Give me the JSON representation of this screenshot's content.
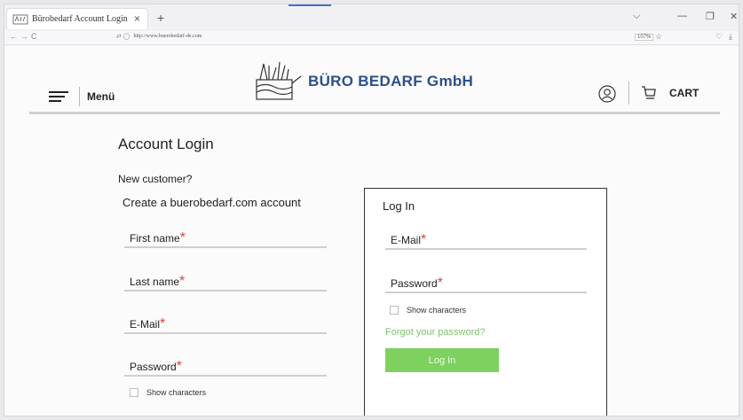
{
  "browser": {
    "tab_title": "Bürobedarf Account Login",
    "tab_close": "×",
    "new_tab": "+",
    "url": "http://www.buerobedarf-de.com",
    "zoom": "107%",
    "controls": {
      "dropdown": "⌵",
      "minimize": "—",
      "restore": "❐",
      "close": "✕"
    },
    "nav": {
      "back": "←",
      "forward": "→",
      "reload": "C"
    },
    "addr_icons": "⇄ ◯",
    "bookmark_star": "☆",
    "nav_right": [
      "♡",
      "⤓"
    ]
  },
  "header": {
    "menu_label": "Menü",
    "brand": "BÜRO BEDARF GmbH",
    "cart_label": "CART",
    "icons": [
      "hamburger-icon",
      "logo-icon",
      "user-icon",
      "cart-icon"
    ]
  },
  "page": {
    "title": "Account Login",
    "new_customer": "New customer?",
    "create_account": "Create a buerobedarf.com account",
    "required_mark": "*",
    "register_fields": {
      "first_name": "First name",
      "last_name": "Last name",
      "email": "E-Mail",
      "password": "Password"
    },
    "show_characters": "Show characters"
  },
  "login": {
    "title": "Log In",
    "email": "E-Mail",
    "password": "Password",
    "show_characters": "Show characters",
    "forgot": "Forgot your password?",
    "button": "Log In"
  },
  "colors": {
    "brand": "#2b4f8f",
    "required": "#d14a4a",
    "link": "#7bc36a",
    "button": "#7ed15e"
  }
}
